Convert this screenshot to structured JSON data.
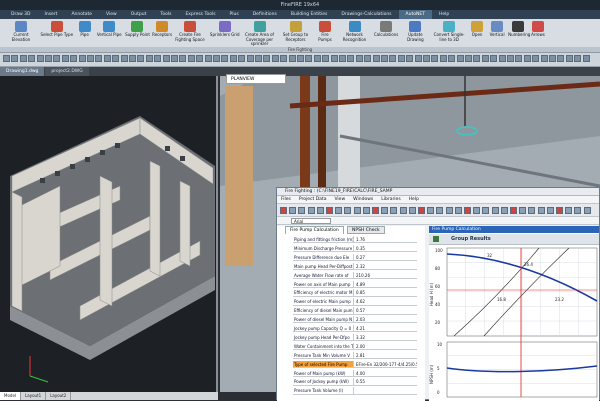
{
  "window": {
    "title": "FineFIRE 19x64"
  },
  "ribbon": {
    "tabs": [
      "Draw 3D",
      "Insert",
      "Annotate",
      "View",
      "Output",
      "Tools",
      "Express Tools",
      "Plus",
      "Definitions",
      "Building Entities",
      "Drawings-Calculations",
      "AutoNET",
      "Help"
    ],
    "active_tab": "AutoNET",
    "buttons": [
      "Current Elevation",
      "Select Pipe Type",
      "Pipe",
      "Vertical Pipe",
      "Supply Point",
      "Receptors",
      "Create Fire Fighting Space",
      "Sprinklers Grid",
      "Create Area of Coverage per sprinkler",
      "Set Group to Receptors",
      "Fire Pumps",
      "Network Recognition",
      "Calculations",
      "Update Drawing",
      "Convert Single-line to 3D",
      "Open",
      "Vertical",
      "Numbering",
      "Arrows"
    ],
    "panel_label": "Fire Fighting"
  },
  "file_tabs": [
    "Drawing1.dwg",
    "project2.DWG"
  ],
  "viewport": {
    "label": "PLANVIEW"
  },
  "layout_tabs": [
    "Model",
    "Layout1",
    "Layout2"
  ],
  "ff": {
    "title": "Fire Fighting : (C:\\FINE19_FIRE\\CALC\\FIRE_SAMP",
    "menu": [
      "Files",
      "Project Data",
      "View",
      "Windows",
      "Libraries",
      "Help"
    ],
    "font_box": "Arial",
    "tabs": [
      "Fire Pump Calculation",
      "NPSH Check"
    ],
    "rows": [
      {
        "label": "Piping and fittings friction (m)",
        "value": "1.76"
      },
      {
        "label": "Minimum Discharge Pressure",
        "value": "0.35"
      },
      {
        "label": "Pressure Difference due Ele",
        "value": "0.27"
      },
      {
        "label": "Main pump Head Per-Diffpost",
        "value": "2.32"
      },
      {
        "label": "Average Water Flow rate of",
        "value": "210.26"
      },
      {
        "label": "Power on axis of Main pump",
        "value": "4.89"
      },
      {
        "label": "Efficiency of electric motor M",
        "value": "0.85"
      },
      {
        "label": "Power of electric Main pump",
        "value": "4.62"
      },
      {
        "label": "Efficiency of diesel Main pum",
        "value": "0.57"
      },
      {
        "label": "Power of diesel Main pump N",
        "value": "2.03"
      },
      {
        "label": "Jockey pump Capacity Q = 0",
        "value": "4.21"
      },
      {
        "label": "Jockey pump Head Per-Dfpo",
        "value": "3.32"
      },
      {
        "label": "Water Containment into the T",
        "value": "2.00"
      },
      {
        "label": "Pressure Tank Min Volume V",
        "value": "2.81"
      },
      {
        "label": "Type of selected Fire Pump",
        "value": "EFire-En 32/200-177-4/4.25/0.55",
        "highlight": true
      },
      {
        "label": "Power of Main pump (kW)",
        "value": "4.00"
      },
      {
        "label": "Power of Jockey pump (kW)",
        "value": "0.55"
      },
      {
        "label": "Pressure Tank Volume (l)",
        "value": ""
      }
    ],
    "calc_header": "Fire Pump Calculation",
    "group_button": "Group Results",
    "chart_top": {
      "ylabel": "Head H (m)",
      "xlabel": "Flow Q (m³/h)",
      "yticks": [
        "100",
        "80",
        "60",
        "40",
        "20"
      ],
      "xticks": [
        "0",
        "10",
        "20",
        "30"
      ],
      "labels": [
        "32",
        "26.4",
        "16.8",
        "23.2"
      ]
    },
    "chart_bottom": {
      "ylabel": "NPSH (m)",
      "yticks": [
        "10",
        "5",
        "0"
      ]
    }
  }
}
